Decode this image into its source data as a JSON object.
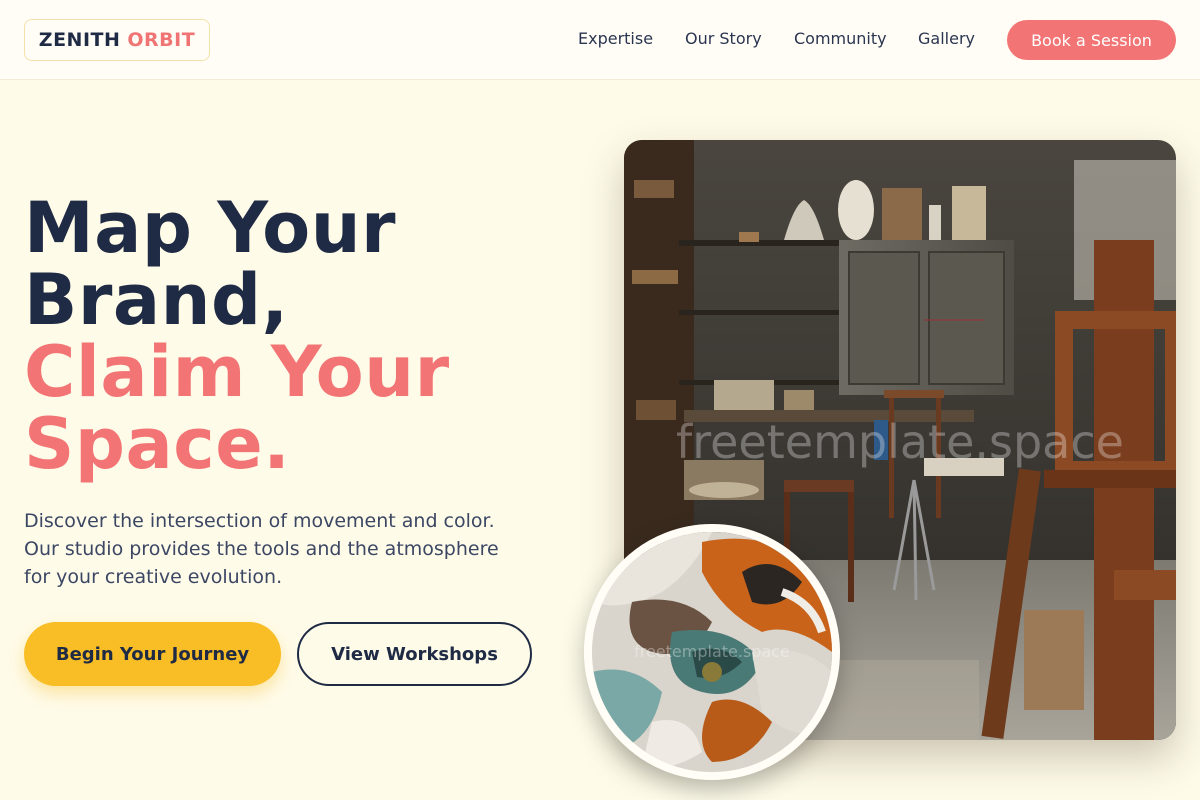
{
  "brand": {
    "name_part1": "ZENITH",
    "name_part2": "ORBIT"
  },
  "nav": {
    "items": [
      "Expertise",
      "Our Story",
      "Community",
      "Gallery"
    ],
    "cta_label": "Book a Session"
  },
  "hero": {
    "headline_line1": "Map Your",
    "headline_line2": "Brand,",
    "headline_accent_line1": "Claim Your",
    "headline_accent_line2": "Space.",
    "description_line1": "Discover the intersection of movement and color.",
    "description_line2": "Our studio provides the tools and the atmosphere",
    "description_line3": "for your creative evolution.",
    "primary_button": "Begin Your Journey",
    "secondary_button": "View Workshops"
  },
  "images": {
    "main_watermark": "freetemplate.space",
    "circle_watermark": "freetemplate.space"
  },
  "colors": {
    "background": "#fefbe9",
    "navy": "#1f2a44",
    "coral": "#f27474",
    "yellow": "#f9bd25"
  }
}
